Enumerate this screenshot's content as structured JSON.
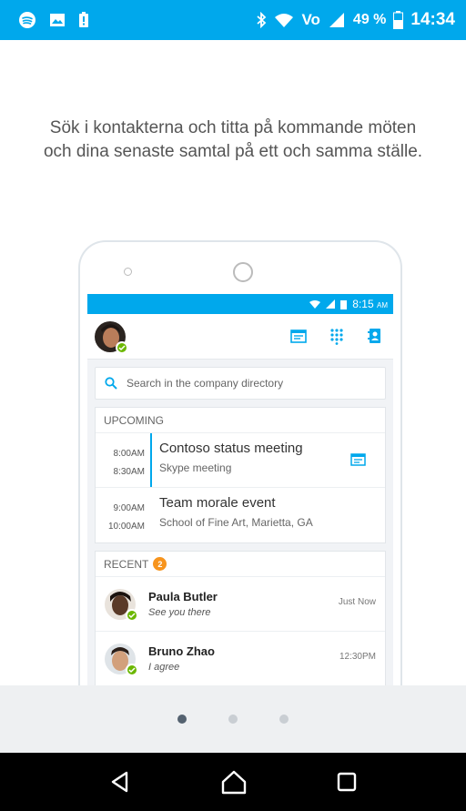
{
  "status_bar": {
    "battery_percent": "49 %",
    "time": "14:34",
    "volte": "Vo",
    "icons": [
      "spotify-icon",
      "image-icon",
      "alert-icon",
      "bluetooth-icon",
      "wifi-icon",
      "volte-icon",
      "signal-icon",
      "battery-icon"
    ]
  },
  "intro": {
    "line1": "Sök i kontakterna och titta på kommande möten",
    "line2": "och dina senaste samtal på ett och samma ställe."
  },
  "screen": {
    "status_time": "8:15",
    "status_ampm": "AM",
    "search_placeholder": "Search in the company directory",
    "upcoming": {
      "title": "UPCOMING",
      "meetings": [
        {
          "start": "8:00AM",
          "end": "8:30AM",
          "title": "Contoso status meeting",
          "subtitle": "Skype meeting"
        },
        {
          "start": "9:00AM",
          "end": "10:00AM",
          "title": "Team morale event",
          "subtitle": "School of Fine Art, Marietta, GA"
        }
      ]
    },
    "recent": {
      "title": "RECENT",
      "badge": "2",
      "items": [
        {
          "name": "Paula Butler",
          "message": "See you there",
          "time": "Just Now"
        },
        {
          "name": "Bruno Zhao",
          "message": "I agree",
          "time": "12:30PM"
        }
      ]
    }
  },
  "pager": {
    "count": 3,
    "active": 0
  },
  "colors": {
    "accent": "#00a8ec",
    "presence": "#6bb700",
    "badge": "#f7941d"
  }
}
